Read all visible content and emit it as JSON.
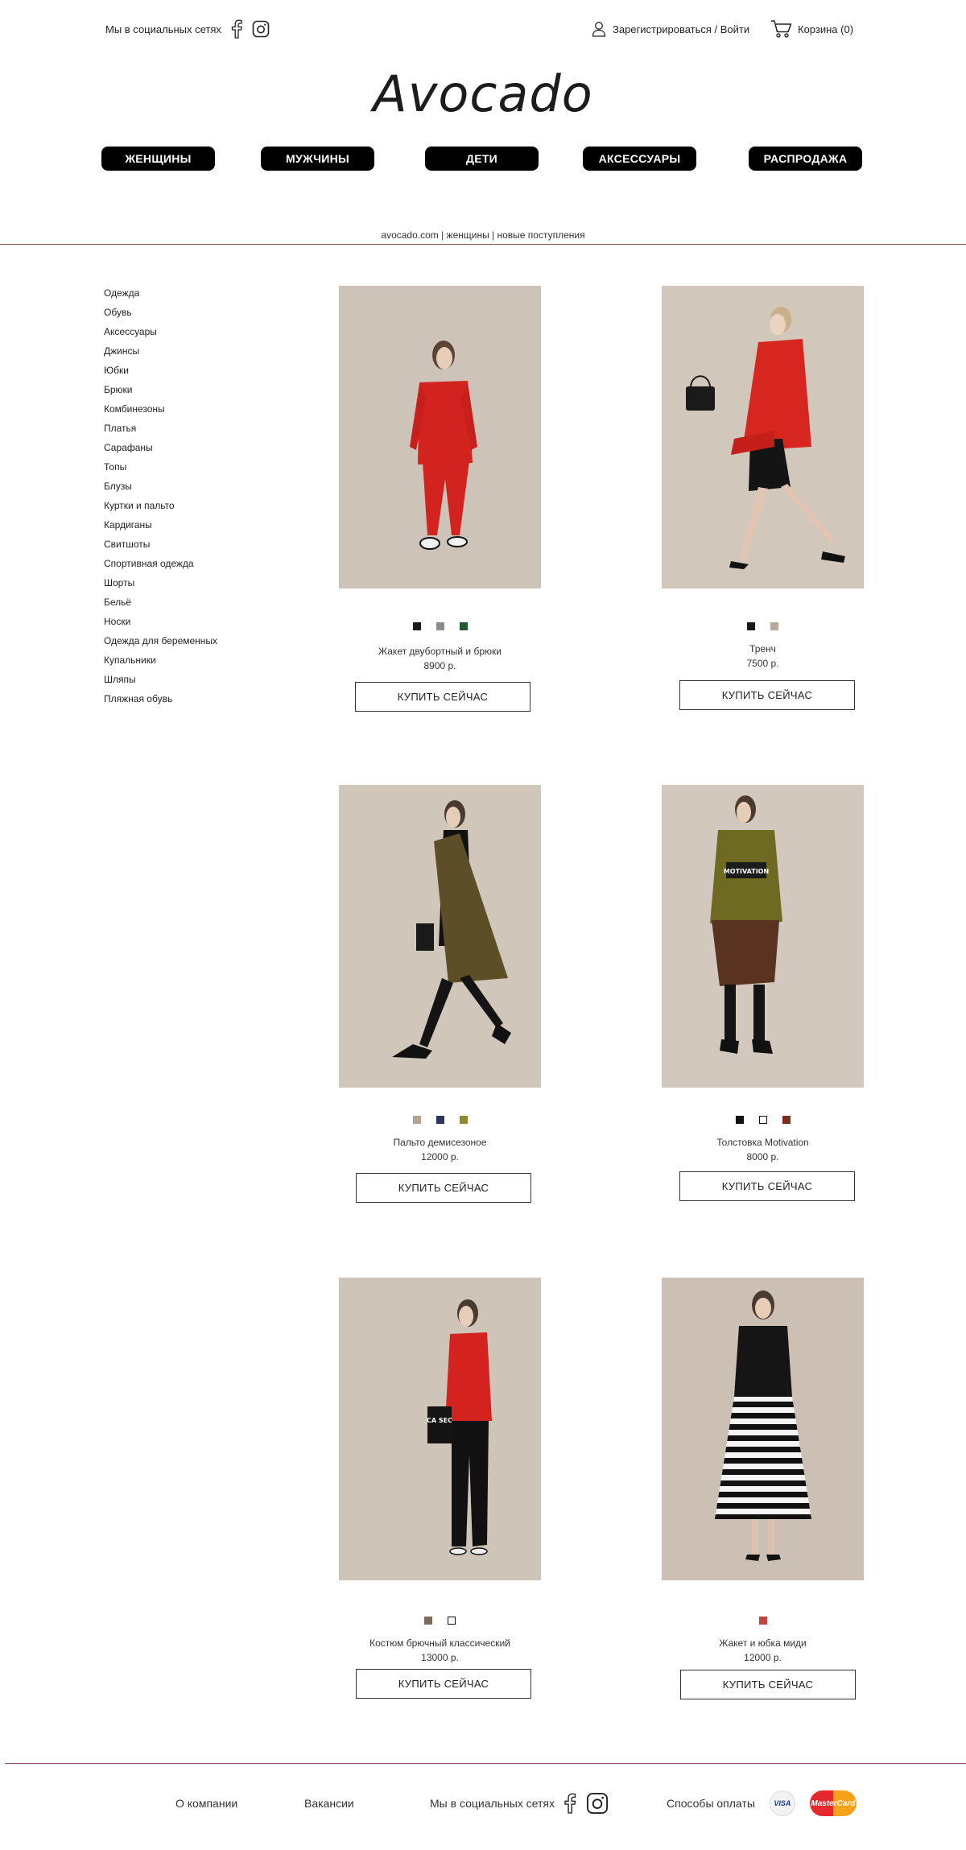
{
  "header": {
    "social_label": "Мы в социальных сетях",
    "account_label": "Зарегистрироваться / Войти",
    "cart_label": "Корзина (0)",
    "logo": "Avocado"
  },
  "nav": [
    "ЖЕНЩИНЫ",
    "МУЖЧИНЫ",
    "ДЕТИ",
    "АКСЕССУАРЫ",
    "РАСПРОДАЖА"
  ],
  "breadcrumb": "avocado.com | женщины | новые поступления",
  "sidebar": [
    "Одежда",
    "Обувь",
    "Аксессуары",
    "Джинсы",
    "Юбки",
    "Брюки",
    "Комбинезоны",
    "Платья",
    "Сарафаны",
    "Топы",
    "Блузы",
    "Куртки и пальто",
    "Кардиганы",
    "Свитшоты",
    "Спортивная одежда",
    "Шорты",
    "Бельё",
    "Носки",
    "Одежда для беременных",
    "Купальники",
    "Шляпы",
    "Пляжная обувь"
  ],
  "buy_label": "КУПИТЬ СЕЙЧАС",
  "products": [
    {
      "name": "Жакет двубортный и брюки",
      "price": "8900 р.",
      "colors": [
        "#1a1a1a",
        "#8c8c8c",
        "#1f5a32"
      ]
    },
    {
      "name": "Тренч",
      "price": "7500 р.",
      "colors": [
        "#1a1a1a",
        "#b8a898"
      ]
    },
    {
      "name": "Пальто демисезоное",
      "price": "12000 р.",
      "colors": [
        "#b5a48c",
        "#2c3560",
        "#8c8a2e"
      ]
    },
    {
      "name": "Толстовка Motivation",
      "price": "8000 р.",
      "colors": [
        "#111111",
        "#ffffff",
        "#7a2c1e"
      ]
    },
    {
      "name": "Костюм брючный классический",
      "price": "13000 р.",
      "colors": [
        "#7d6a5a",
        "#ffffff"
      ]
    },
    {
      "name": "Жакет и юбка миди",
      "price": "12000 р.",
      "colors": [
        "#c0453a"
      ]
    }
  ],
  "product_prints": {
    "hoodie_text": "MOTIVATION",
    "clutch_text": "CA SEC"
  },
  "footer": {
    "about": "О компании",
    "jobs": "Вакансии",
    "social": "Мы в социальных сетях",
    "payment": "Способы оплаты",
    "visa": "VISA",
    "mastercard": "MasterCard"
  }
}
